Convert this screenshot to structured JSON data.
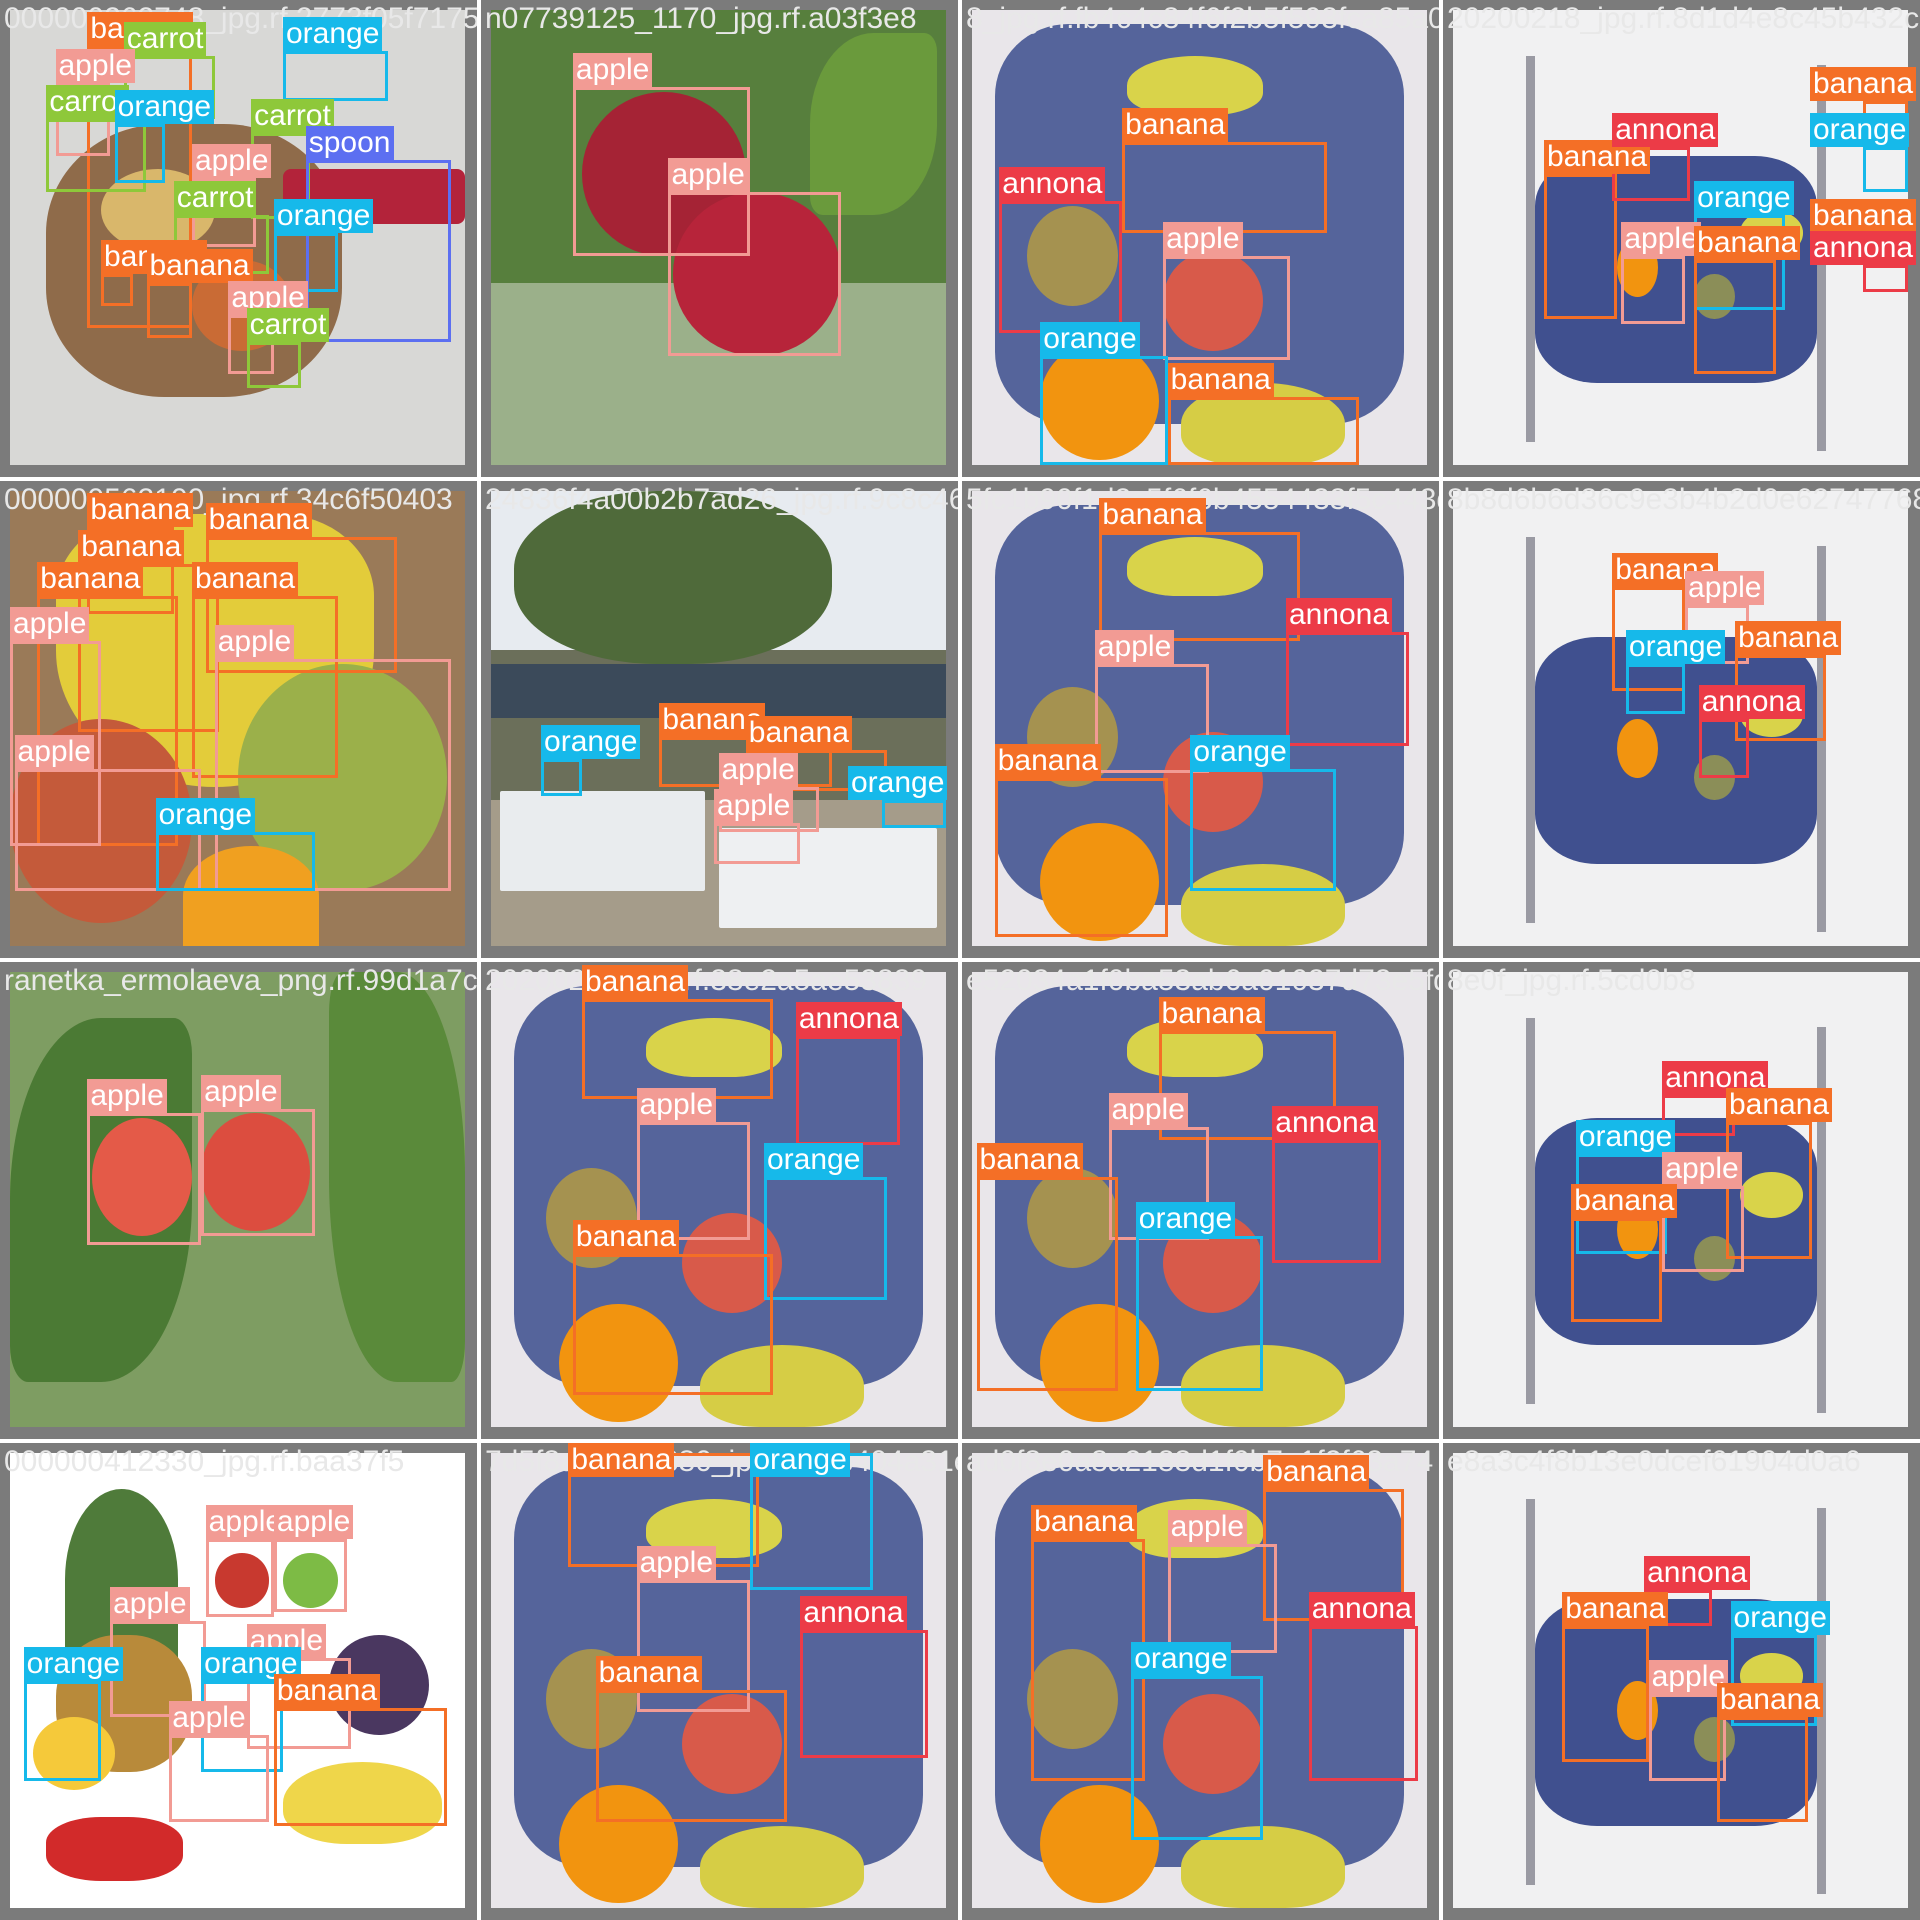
{
  "classes": {
    "apple": {
      "name": "apple",
      "color": "#f29b94"
    },
    "banana": {
      "name": "banana",
      "color": "#f46f26"
    },
    "orange": {
      "name": "orange",
      "color": "#16b9ea"
    },
    "annona": {
      "name": "annona",
      "color": "#ec3b47"
    },
    "carrot": {
      "name": "carrot",
      "color": "#8ec83a"
    },
    "spoon": {
      "name": "spoon",
      "color": "#5c6ff1"
    }
  },
  "tiles": [
    {
      "filename": "000000262748_jpg.rf.2773f05f7175106f0fd994b764d24df6",
      "scene": "fruit-bowl",
      "detections": [
        {
          "cls": "banana",
          "b": [
            0.17,
            0.08,
            0.4,
            0.7
          ]
        },
        {
          "cls": "carrot",
          "b": [
            0.25,
            0.1,
            0.45,
            0.24
          ]
        },
        {
          "cls": "apple",
          "b": [
            0.1,
            0.16,
            0.22,
            0.32
          ]
        },
        {
          "cls": "orange",
          "b": [
            0.6,
            0.09,
            0.83,
            0.2
          ]
        },
        {
          "cls": "carrot",
          "b": [
            0.08,
            0.24,
            0.3,
            0.4
          ]
        },
        {
          "cls": "orange",
          "b": [
            0.23,
            0.25,
            0.34,
            0.38
          ]
        },
        {
          "cls": "carrot",
          "b": [
            0.53,
            0.27,
            0.66,
            0.46
          ]
        },
        {
          "cls": "spoon",
          "b": [
            0.65,
            0.33,
            0.97,
            0.73
          ]
        },
        {
          "cls": "apple",
          "b": [
            0.4,
            0.37,
            0.54,
            0.52
          ]
        },
        {
          "cls": "carrot",
          "b": [
            0.36,
            0.45,
            0.57,
            0.58
          ]
        },
        {
          "cls": "orange",
          "b": [
            0.58,
            0.49,
            0.72,
            0.62
          ]
        },
        {
          "cls": "banana",
          "b": [
            0.2,
            0.58,
            0.27,
            0.65
          ]
        },
        {
          "cls": "banana",
          "b": [
            0.3,
            0.6,
            0.4,
            0.72
          ]
        },
        {
          "cls": "apple",
          "b": [
            0.48,
            0.67,
            0.58,
            0.8
          ]
        },
        {
          "cls": "carrot",
          "b": [
            0.52,
            0.73,
            0.64,
            0.83
          ]
        }
      ]
    },
    {
      "filename": "n07739125_1170_jpg.rf.a03f3e8",
      "scene": "red-apples-tree",
      "detections": [
        {
          "cls": "apple",
          "b": [
            0.18,
            0.17,
            0.57,
            0.54
          ]
        },
        {
          "cls": "apple",
          "b": [
            0.39,
            0.4,
            0.77,
            0.76
          ]
        }
      ]
    },
    {
      "filename": "8_jpg.rf.fb4c4c84f6f2b5f593fca85a0e",
      "scene": "chair-fruits",
      "detections": [
        {
          "cls": "banana",
          "b": [
            0.33,
            0.29,
            0.78,
            0.49
          ]
        },
        {
          "cls": "annona",
          "b": [
            0.06,
            0.42,
            0.33,
            0.71
          ]
        },
        {
          "cls": "apple",
          "b": [
            0.42,
            0.54,
            0.7,
            0.77
          ]
        },
        {
          "cls": "orange",
          "b": [
            0.15,
            0.76,
            0.43,
            1.0
          ]
        },
        {
          "cls": "banana",
          "b": [
            0.43,
            0.85,
            0.85,
            1.0
          ]
        }
      ]
    },
    {
      "filename": "20200218_jpg.rf.8d1d4e8c45b432ccbcaa",
      "scene": "chair-top-view",
      "detections": [
        {
          "cls": "banana",
          "b": [
            0.2,
            0.36,
            0.36,
            0.68
          ]
        },
        {
          "cls": "apple",
          "b": [
            0.37,
            0.54,
            0.51,
            0.69
          ]
        },
        {
          "cls": "orange",
          "b": [
            0.53,
            0.45,
            0.73,
            0.66
          ]
        },
        {
          "cls": "banana",
          "b": [
            0.53,
            0.55,
            0.71,
            0.8
          ]
        },
        {
          "cls": "annona",
          "b": [
            0.35,
            0.3,
            0.52,
            0.42
          ]
        },
        {
          "cls": "banana",
          "b": [
            0.9,
            0.2,
            1.0,
            0.3
          ]
        },
        {
          "cls": "orange",
          "b": [
            0.9,
            0.3,
            1.0,
            0.4
          ]
        },
        {
          "cls": "banana",
          "b": [
            0.9,
            0.49,
            1.0,
            0.56
          ]
        },
        {
          "cls": "annona",
          "b": [
            0.9,
            0.56,
            1.0,
            0.62
          ]
        }
      ]
    },
    {
      "filename": "000000562100_jpg.rf.34c6f50403",
      "scene": "bananas-apples-box",
      "detections": [
        {
          "cls": "banana",
          "b": [
            0.17,
            0.08,
            0.36,
            0.27
          ]
        },
        {
          "cls": "banana",
          "b": [
            0.43,
            0.1,
            0.85,
            0.4
          ]
        },
        {
          "cls": "banana",
          "b": [
            0.15,
            0.16,
            0.46,
            0.53
          ]
        },
        {
          "cls": "banana",
          "b": [
            0.06,
            0.23,
            0.37,
            0.78
          ]
        },
        {
          "cls": "banana",
          "b": [
            0.4,
            0.23,
            0.72,
            0.63
          ]
        },
        {
          "cls": "apple",
          "b": [
            0.0,
            0.33,
            0.2,
            0.78
          ]
        },
        {
          "cls": "apple",
          "b": [
            0.45,
            0.37,
            0.97,
            0.88
          ]
        },
        {
          "cls": "apple",
          "b": [
            0.01,
            0.61,
            0.42,
            0.88
          ]
        },
        {
          "cls": "orange",
          "b": [
            0.32,
            0.75,
            0.67,
            0.88
          ]
        }
      ]
    },
    {
      "filename": "24836f4a00b2b7ad26_jpg.rf.9c8c46",
      "scene": "fruit-market",
      "detections": [
        {
          "cls": "banana",
          "b": [
            0.37,
            0.54,
            0.75,
            0.65
          ]
        },
        {
          "cls": "orange",
          "b": [
            0.11,
            0.59,
            0.2,
            0.67
          ]
        },
        {
          "cls": "banana",
          "b": [
            0.56,
            0.57,
            0.87,
            0.66
          ]
        },
        {
          "cls": "apple",
          "b": [
            0.5,
            0.65,
            0.72,
            0.75
          ]
        },
        {
          "cls": "orange",
          "b": [
            0.86,
            0.68,
            1.0,
            0.74
          ]
        },
        {
          "cls": "apple",
          "b": [
            0.49,
            0.73,
            0.68,
            0.82
          ]
        }
      ]
    },
    {
      "filename": "5fc1b90f1d2c5f6f6b4554433f5c443d2aa53c",
      "scene": "chair-fruits",
      "detections": [
        {
          "cls": "banana",
          "b": [
            0.28,
            0.09,
            0.72,
            0.33
          ]
        },
        {
          "cls": "apple",
          "b": [
            0.27,
            0.38,
            0.52,
            0.62
          ]
        },
        {
          "cls": "annona",
          "b": [
            0.69,
            0.31,
            0.96,
            0.56
          ]
        },
        {
          "cls": "orange",
          "b": [
            0.48,
            0.61,
            0.8,
            0.88
          ]
        },
        {
          "cls": "banana",
          "b": [
            0.05,
            0.63,
            0.43,
            0.98
          ]
        }
      ]
    },
    {
      "filename": "8b8d6b6d36c9e3b4b2d0e627477681fe",
      "scene": "chair-top-view",
      "detections": [
        {
          "cls": "banana",
          "b": [
            0.35,
            0.21,
            0.51,
            0.44
          ]
        },
        {
          "cls": "apple",
          "b": [
            0.51,
            0.25,
            0.65,
            0.38
          ]
        },
        {
          "cls": "orange",
          "b": [
            0.38,
            0.38,
            0.51,
            0.49
          ]
        },
        {
          "cls": "banana",
          "b": [
            0.62,
            0.36,
            0.82,
            0.55
          ]
        },
        {
          "cls": "annona",
          "b": [
            0.54,
            0.5,
            0.65,
            0.63
          ]
        }
      ]
    },
    {
      "filename": "ranetka_ermolaeva_png.rf.99d1a7c",
      "scene": "crabapple-leaves",
      "detections": [
        {
          "cls": "apple",
          "b": [
            0.17,
            0.31,
            0.42,
            0.6
          ]
        },
        {
          "cls": "apple",
          "b": [
            0.42,
            0.3,
            0.67,
            0.58
          ]
        }
      ]
    },
    {
      "filename": "20200218_jpg.rf.38e2a5ae53839",
      "scene": "chair-fruits",
      "detections": [
        {
          "cls": "banana",
          "b": [
            0.2,
            0.06,
            0.62,
            0.28
          ]
        },
        {
          "cls": "annona",
          "b": [
            0.67,
            0.14,
            0.9,
            0.38
          ]
        },
        {
          "cls": "apple",
          "b": [
            0.32,
            0.33,
            0.57,
            0.59
          ]
        },
        {
          "cls": "orange",
          "b": [
            0.6,
            0.45,
            0.87,
            0.72
          ]
        },
        {
          "cls": "banana",
          "b": [
            0.18,
            0.62,
            0.62,
            0.93
          ]
        }
      ]
    },
    {
      "filename": "e52034a1f0ba53ab6a01037d73e5fd29",
      "scene": "chair-fruits",
      "detections": [
        {
          "cls": "banana",
          "b": [
            0.41,
            0.13,
            0.8,
            0.37
          ]
        },
        {
          "cls": "apple",
          "b": [
            0.3,
            0.34,
            0.52,
            0.59
          ]
        },
        {
          "cls": "annona",
          "b": [
            0.66,
            0.37,
            0.9,
            0.64
          ]
        },
        {
          "cls": "banana",
          "b": [
            0.01,
            0.45,
            0.32,
            0.92
          ]
        },
        {
          "cls": "orange",
          "b": [
            0.36,
            0.58,
            0.64,
            0.92
          ]
        }
      ]
    },
    {
      "filename": "8e0f_jpg.rf.5cd0b8",
      "scene": "chair-top-view",
      "detections": [
        {
          "cls": "annona",
          "b": [
            0.46,
            0.27,
            0.62,
            0.36
          ]
        },
        {
          "cls": "orange",
          "b": [
            0.27,
            0.4,
            0.47,
            0.62
          ]
        },
        {
          "cls": "banana",
          "b": [
            0.6,
            0.33,
            0.79,
            0.63
          ]
        },
        {
          "cls": "apple",
          "b": [
            0.46,
            0.47,
            0.64,
            0.66
          ]
        },
        {
          "cls": "banana",
          "b": [
            0.26,
            0.54,
            0.46,
            0.77
          ]
        }
      ]
    },
    {
      "filename": "000000412330_jpg.rf.baa37f5",
      "scene": "fruit-assortment",
      "detections": [
        {
          "cls": "apple",
          "b": [
            0.43,
            0.19,
            0.58,
            0.36
          ]
        },
        {
          "cls": "apple",
          "b": [
            0.58,
            0.19,
            0.74,
            0.35
          ]
        },
        {
          "cls": "apple",
          "b": [
            0.22,
            0.37,
            0.43,
            0.58
          ]
        },
        {
          "cls": "apple",
          "b": [
            0.52,
            0.45,
            0.75,
            0.65
          ]
        },
        {
          "cls": "orange",
          "b": [
            0.03,
            0.5,
            0.2,
            0.72
          ]
        },
        {
          "cls": "orange",
          "b": [
            0.42,
            0.5,
            0.6,
            0.7
          ]
        },
        {
          "cls": "apple",
          "b": [
            0.35,
            0.62,
            0.57,
            0.81
          ]
        },
        {
          "cls": "banana",
          "b": [
            0.58,
            0.56,
            0.96,
            0.82
          ]
        }
      ]
    },
    {
      "filename": "7d5f8a-b0f75880_jpg.rf.e8b404a31ea",
      "scene": "chair-fruits",
      "detections": [
        {
          "cls": "banana",
          "b": [
            0.17,
            0.0,
            0.59,
            0.25
          ]
        },
        {
          "cls": "orange",
          "b": [
            0.57,
            0.0,
            0.84,
            0.3
          ]
        },
        {
          "cls": "apple",
          "b": [
            0.32,
            0.28,
            0.57,
            0.57
          ]
        },
        {
          "cls": "annona",
          "b": [
            0.68,
            0.39,
            0.96,
            0.67
          ]
        },
        {
          "cls": "banana",
          "b": [
            0.23,
            0.52,
            0.65,
            0.81
          ]
        }
      ]
    },
    {
      "filename": "ad0f8e0a8a2188d1f0b7e1f2f63a74",
      "scene": "chair-fruits",
      "detections": [
        {
          "cls": "banana",
          "b": [
            0.64,
            0.08,
            0.95,
            0.37
          ]
        },
        {
          "cls": "apple",
          "b": [
            0.43,
            0.2,
            0.67,
            0.44
          ]
        },
        {
          "cls": "banana",
          "b": [
            0.13,
            0.19,
            0.38,
            0.72
          ]
        },
        {
          "cls": "annona",
          "b": [
            0.74,
            0.38,
            0.98,
            0.72
          ]
        },
        {
          "cls": "orange",
          "b": [
            0.35,
            0.49,
            0.64,
            0.85
          ]
        }
      ]
    },
    {
      "filename": "e8a3c4f8b13e0dcef61904d0a6",
      "scene": "chair-top-view",
      "detections": [
        {
          "cls": "annona",
          "b": [
            0.42,
            0.3,
            0.57,
            0.38
          ]
        },
        {
          "cls": "banana",
          "b": [
            0.24,
            0.38,
            0.43,
            0.68
          ]
        },
        {
          "cls": "orange",
          "b": [
            0.61,
            0.4,
            0.8,
            0.6
          ]
        },
        {
          "cls": "apple",
          "b": [
            0.43,
            0.53,
            0.6,
            0.72
          ]
        },
        {
          "cls": "banana",
          "b": [
            0.58,
            0.58,
            0.78,
            0.81
          ]
        }
      ]
    }
  ]
}
